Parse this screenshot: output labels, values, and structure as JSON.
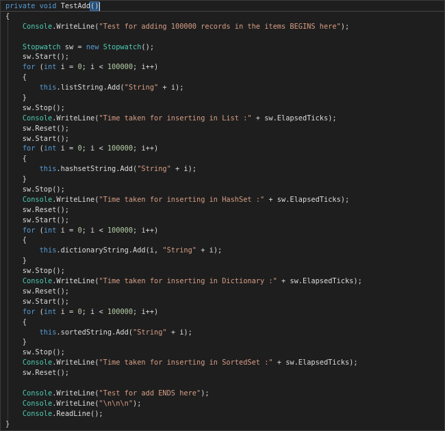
{
  "editor": {
    "lines": [
      [
        [
          "kw",
          "private"
        ],
        [
          "tx",
          " "
        ],
        [
          "kw",
          "void"
        ],
        [
          "tx",
          " TestAdd"
        ],
        [
          "br",
          "()"
        ]
      ],
      [
        [
          "tx",
          "{"
        ]
      ],
      [
        [
          "tx",
          "    "
        ],
        [
          "ty",
          "Console"
        ],
        [
          "tx",
          ".WriteLine("
        ],
        [
          "st",
          "\"Test for adding 100000 records in the items BEGINS here\""
        ],
        [
          "tx",
          ");"
        ]
      ],
      [],
      [
        [
          "tx",
          "    "
        ],
        [
          "ty",
          "Stopwatch"
        ],
        [
          "tx",
          " sw = "
        ],
        [
          "kw",
          "new"
        ],
        [
          "tx",
          " "
        ],
        [
          "ty",
          "Stopwatch"
        ],
        [
          "tx",
          "();"
        ]
      ],
      [
        [
          "tx",
          "    sw.Start();"
        ]
      ],
      [
        [
          "tx",
          "    "
        ],
        [
          "kw",
          "for"
        ],
        [
          "tx",
          " ("
        ],
        [
          "kw",
          "int"
        ],
        [
          "tx",
          " i = "
        ],
        [
          "nu",
          "0"
        ],
        [
          "tx",
          "; i < "
        ],
        [
          "nu",
          "100000"
        ],
        [
          "tx",
          "; i++)"
        ]
      ],
      [
        [
          "tx",
          "    {"
        ]
      ],
      [
        [
          "tx",
          "        "
        ],
        [
          "kw",
          "this"
        ],
        [
          "tx",
          ".listString.Add("
        ],
        [
          "st",
          "\"String\""
        ],
        [
          "tx",
          " + i);"
        ]
      ],
      [
        [
          "tx",
          "    }"
        ]
      ],
      [
        [
          "tx",
          "    sw.Stop();"
        ]
      ],
      [
        [
          "tx",
          "    "
        ],
        [
          "ty",
          "Console"
        ],
        [
          "tx",
          ".WriteLine("
        ],
        [
          "st",
          "\"Time taken for inserting in List :\""
        ],
        [
          "tx",
          " + sw.ElapsedTicks);"
        ]
      ],
      [
        [
          "tx",
          "    sw.Reset();"
        ]
      ],
      [
        [
          "tx",
          "    sw.Start();"
        ]
      ],
      [
        [
          "tx",
          "    "
        ],
        [
          "kw",
          "for"
        ],
        [
          "tx",
          " ("
        ],
        [
          "kw",
          "int"
        ],
        [
          "tx",
          " i = "
        ],
        [
          "nu",
          "0"
        ],
        [
          "tx",
          "; i < "
        ],
        [
          "nu",
          "100000"
        ],
        [
          "tx",
          "; i++)"
        ]
      ],
      [
        [
          "tx",
          "    {"
        ]
      ],
      [
        [
          "tx",
          "        "
        ],
        [
          "kw",
          "this"
        ],
        [
          "tx",
          ".hashsetString.Add("
        ],
        [
          "st",
          "\"String\""
        ],
        [
          "tx",
          " + i);"
        ]
      ],
      [
        [
          "tx",
          "    }"
        ]
      ],
      [
        [
          "tx",
          "    sw.Stop();"
        ]
      ],
      [
        [
          "tx",
          "    "
        ],
        [
          "ty",
          "Console"
        ],
        [
          "tx",
          ".WriteLine("
        ],
        [
          "st",
          "\"Time taken for inserting in HashSet :\""
        ],
        [
          "tx",
          " + sw.ElapsedTicks);"
        ]
      ],
      [
        [
          "tx",
          "    sw.Reset();"
        ]
      ],
      [
        [
          "tx",
          "    sw.Start();"
        ]
      ],
      [
        [
          "tx",
          "    "
        ],
        [
          "kw",
          "for"
        ],
        [
          "tx",
          " ("
        ],
        [
          "kw",
          "int"
        ],
        [
          "tx",
          " i = "
        ],
        [
          "nu",
          "0"
        ],
        [
          "tx",
          "; i < "
        ],
        [
          "nu",
          "100000"
        ],
        [
          "tx",
          "; i++)"
        ]
      ],
      [
        [
          "tx",
          "    {"
        ]
      ],
      [
        [
          "tx",
          "        "
        ],
        [
          "kw",
          "this"
        ],
        [
          "tx",
          ".dictionaryString.Add(i, "
        ],
        [
          "st",
          "\"String\""
        ],
        [
          "tx",
          " + i);"
        ]
      ],
      [
        [
          "tx",
          "    }"
        ]
      ],
      [
        [
          "tx",
          "    sw.Stop();"
        ]
      ],
      [
        [
          "tx",
          "    "
        ],
        [
          "ty",
          "Console"
        ],
        [
          "tx",
          ".WriteLine("
        ],
        [
          "st",
          "\"Time taken for inserting in Dictionary :\""
        ],
        [
          "tx",
          " + sw.ElapsedTicks);"
        ]
      ],
      [
        [
          "tx",
          "    sw.Reset();"
        ]
      ],
      [
        [
          "tx",
          "    sw.Start();"
        ]
      ],
      [
        [
          "tx",
          "    "
        ],
        [
          "kw",
          "for"
        ],
        [
          "tx",
          " ("
        ],
        [
          "kw",
          "int"
        ],
        [
          "tx",
          " i = "
        ],
        [
          "nu",
          "0"
        ],
        [
          "tx",
          "; i < "
        ],
        [
          "nu",
          "100000"
        ],
        [
          "tx",
          "; i++)"
        ]
      ],
      [
        [
          "tx",
          "    {"
        ]
      ],
      [
        [
          "tx",
          "        "
        ],
        [
          "kw",
          "this"
        ],
        [
          "tx",
          ".sortedString.Add("
        ],
        [
          "st",
          "\"String\""
        ],
        [
          "tx",
          " + i);"
        ]
      ],
      [
        [
          "tx",
          "    }"
        ]
      ],
      [
        [
          "tx",
          "    sw.Stop();"
        ]
      ],
      [
        [
          "tx",
          "    "
        ],
        [
          "ty",
          "Console"
        ],
        [
          "tx",
          ".WriteLine("
        ],
        [
          "st",
          "\"Time taken for inserting in SortedSet :\""
        ],
        [
          "tx",
          " + sw.ElapsedTicks);"
        ]
      ],
      [
        [
          "tx",
          "    sw.Reset();"
        ]
      ],
      [],
      [
        [
          "tx",
          "    "
        ],
        [
          "ty",
          "Console"
        ],
        [
          "tx",
          ".WriteLine("
        ],
        [
          "st",
          "\"Test for add ENDS here\""
        ],
        [
          "tx",
          ");"
        ]
      ],
      [
        [
          "tx",
          "    "
        ],
        [
          "ty",
          "Console"
        ],
        [
          "tx",
          ".WriteLine("
        ],
        [
          "st",
          "\"\\n\\n\\n\""
        ],
        [
          "tx",
          ");"
        ]
      ],
      [
        [
          "tx",
          "    "
        ],
        [
          "ty",
          "Console"
        ],
        [
          "tx",
          ".ReadLine();"
        ]
      ],
      [
        [
          "tx",
          "}"
        ]
      ]
    ]
  },
  "colors": {
    "background": "#1e1e1e",
    "keyword": "#569cd6",
    "type": "#4ec9b0",
    "string": "#d69d85",
    "number": "#b5cea8",
    "text": "#dcdcdc"
  }
}
